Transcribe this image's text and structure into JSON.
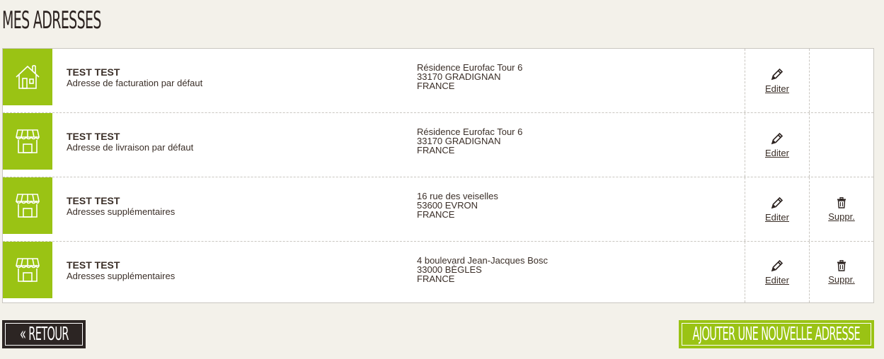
{
  "page": {
    "title": "Mes adresses"
  },
  "addresses": [
    {
      "icon": "house-icon",
      "name": "TEST TEST",
      "type": "Adresse de facturation par défaut",
      "lines": [
        "Résidence Eurofac Tour 6",
        "33170 GRADIGNAN",
        "FRANCE"
      ],
      "edit_label": "Editer",
      "delete_label": ""
    },
    {
      "icon": "store-icon",
      "name": "TEST TEST",
      "type": "Adresse de livraison par défaut",
      "lines": [
        "Résidence Eurofac Tour 6",
        "33170 GRADIGNAN",
        "FRANCE"
      ],
      "edit_label": "Editer",
      "delete_label": ""
    },
    {
      "icon": "store-icon",
      "name": "TEST TEST",
      "type": "Adresses supplémentaires",
      "lines": [
        "16 rue des veiselles",
        "53600 EVRON",
        "FRANCE"
      ],
      "edit_label": "Editer",
      "delete_label": "Suppr."
    },
    {
      "icon": "store-icon",
      "name": "TEST TEST",
      "type": "Adresses supplémentaires",
      "lines": [
        "4 boulevard Jean-Jacques Bosc",
        "33000 BÈGLES",
        "FRANCE"
      ],
      "edit_label": "Editer",
      "delete_label": "Suppr."
    }
  ],
  "buttons": {
    "back_label": "« Retour",
    "add_label": "Ajouter une nouvelle adresse"
  },
  "colors": {
    "accent": "#9ac314",
    "dark": "#2c2523"
  }
}
